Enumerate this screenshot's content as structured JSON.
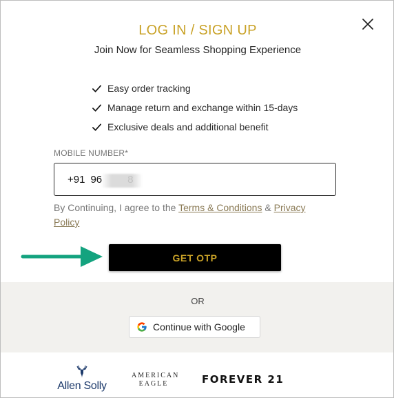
{
  "modal": {
    "title": "LOG IN / SIGN UP",
    "subtitle": "Join Now for Seamless Shopping Experience",
    "close_icon": "close-icon",
    "accent_color": "#c9a227"
  },
  "benefits": [
    {
      "icon": "check-icon",
      "label": "Easy order tracking"
    },
    {
      "icon": "check-icon",
      "label": "Manage return and exchange within 15-days"
    },
    {
      "icon": "check-icon",
      "label": "Exclusive deals and additional benefit"
    }
  ],
  "mobile": {
    "label": "MOBILE NUMBER*",
    "country_code": "+91",
    "value_start": "96",
    "value_end": "8"
  },
  "consent": {
    "text": "By Continuing, I agree to the ",
    "terms_link": "Terms & Conditions",
    "separator": " & ",
    "privacy_link": "Privacy Policy"
  },
  "otp_button": {
    "label": "GET OTP",
    "indicator_icon": "arrow-right-icon",
    "indicator_color": "#14a37f"
  },
  "social": {
    "or_text": "OR",
    "google_label": "Continue with Google",
    "google_icon": "google-icon"
  },
  "brands": {
    "allen_solly": "Allen Solly",
    "allen_solly_icon": "deer-icon",
    "american_eagle_line1": "AMERICAN",
    "american_eagle_line2": "EAGLE",
    "forever21": "FOREVER 21"
  }
}
